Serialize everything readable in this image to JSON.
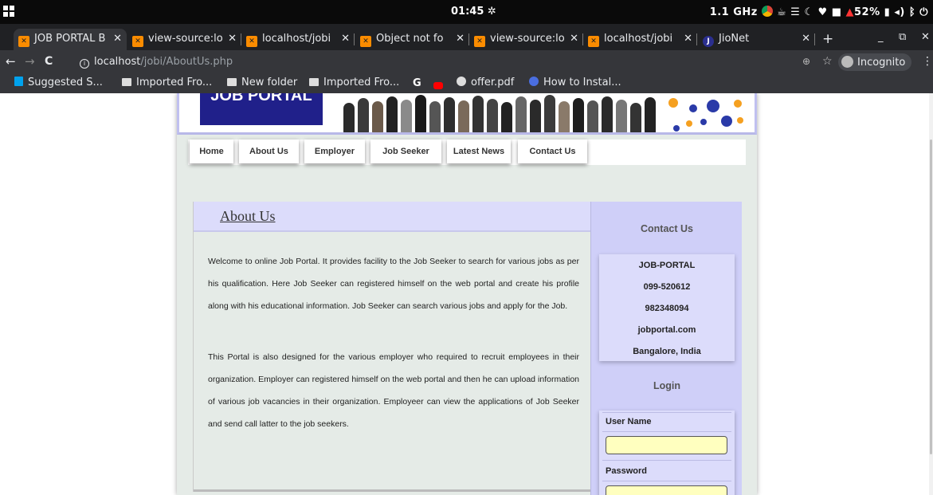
{
  "os": {
    "clock": "01:45",
    "cpu": "1.1 GHz",
    "battery": "52%"
  },
  "tabs": [
    {
      "label": "JOB PORTAL B",
      "favicon": "xampp-icon",
      "active": true
    },
    {
      "label": "view-source:lo",
      "favicon": "xampp-icon"
    },
    {
      "label": "localhost/jobi",
      "favicon": "xampp-icon"
    },
    {
      "label": "Object not fo",
      "favicon": "xampp-icon"
    },
    {
      "label": "view-source:lo",
      "favicon": "xampp-icon"
    },
    {
      "label": "localhost/jobi",
      "favicon": "xampp-icon"
    },
    {
      "label": "JioNet",
      "favicon": "jio-icon"
    }
  ],
  "address_bar": {
    "host": "localhost",
    "path": "/jobi/AboutUs.php",
    "incognito_label": "Incognito"
  },
  "bookmarks": [
    {
      "label": "Suggested S...",
      "icon": "bing-icon"
    },
    {
      "label": "Imported Fro...",
      "icon": "folder-icon"
    },
    {
      "label": "New folder",
      "icon": "folder-icon"
    },
    {
      "label": "Imported Fro...",
      "icon": "folder-icon"
    },
    {
      "label": "",
      "icon": "google-icon"
    },
    {
      "label": "",
      "icon": "youtube-icon"
    },
    {
      "label": "offer.pdf",
      "icon": "globe-icon"
    },
    {
      "label": "How to Instal...",
      "icon": "globe-blue-icon"
    }
  ],
  "site": {
    "logo_text": "JOB PORTAL",
    "nav": [
      "Home",
      "About Us",
      "Employer",
      "Job Seeker",
      "Latest News",
      "Contact Us"
    ],
    "content": {
      "title": "About Us",
      "paragraphs": [
        "Welcome to online Job Portal. It provides facility to the Job Seeker to search for various jobs as per his qualification. Here Job Seeker can registered himself on the web portal and create his profile along with his educational information. Job Seeker can search various jobs and apply for the Job.",
        "This Portal is also designed for the various employer who required to recruit employees in their organization. Employer can registered himself on the web portal and then he can upload information of various job vacancies in their organization. Employeer can view the applications of Job Seeker and send call latter to the job seekers."
      ]
    },
    "sidebar": {
      "contact_heading": "Contact Us",
      "contact_lines": [
        "JOB-PORTAL",
        "099-520612",
        "982348094",
        "jobportal.com",
        "Bangalore, India"
      ],
      "login_heading": "Login",
      "username_label": "User Name",
      "password_label": "Password"
    }
  },
  "colors": {
    "page_bg": "#e5ebe7",
    "title_bar": "#dcdcfb",
    "sidebar_bg": "#cfcff8",
    "logo_bg": "#20208a",
    "input_bg": "#ffffbf"
  }
}
